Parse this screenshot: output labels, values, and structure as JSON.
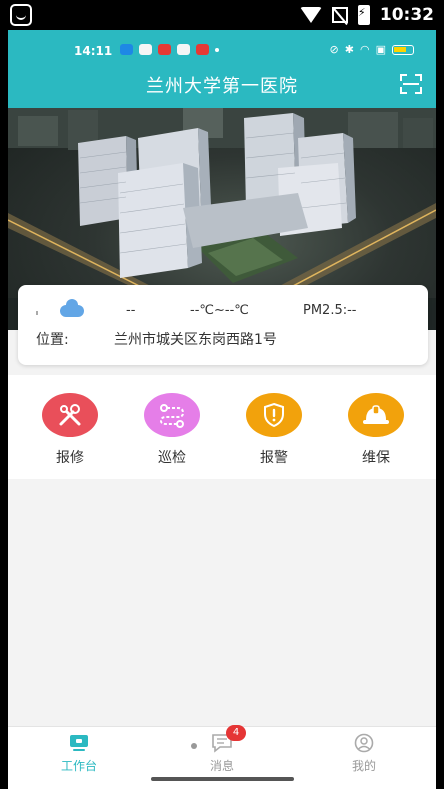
{
  "system": {
    "time": "10:32"
  },
  "app": {
    "inner_time": "14:11",
    "title": "兰州大学第一医院"
  },
  "weather": {
    "description": "--",
    "temperature": "--℃~--℃",
    "pm25": "PM2.5:--",
    "location_label": "位置:",
    "location_value": "兰州市城关区东岗西路1号"
  },
  "functions": [
    {
      "label": "报修",
      "color": "#e94f5a",
      "icon": "tools-icon"
    },
    {
      "label": "巡检",
      "color": "#e57ee8",
      "icon": "route-icon"
    },
    {
      "label": "报警",
      "color": "#f2a20c",
      "icon": "alarm-shield-icon"
    },
    {
      "label": "维保",
      "color": "#f2a20c",
      "icon": "helmet-icon"
    }
  ],
  "nav": {
    "items": [
      {
        "label": "工作台",
        "active": true,
        "icon": "workbench-icon"
      },
      {
        "label": "消息",
        "active": false,
        "icon": "message-icon"
      },
      {
        "label": "我的",
        "active": false,
        "icon": "profile-icon"
      }
    ],
    "message_badge": "4"
  },
  "colors": {
    "primary": "#2bb9c1",
    "active_nav": "#2bb9c1",
    "inactive_nav": "#999999"
  }
}
